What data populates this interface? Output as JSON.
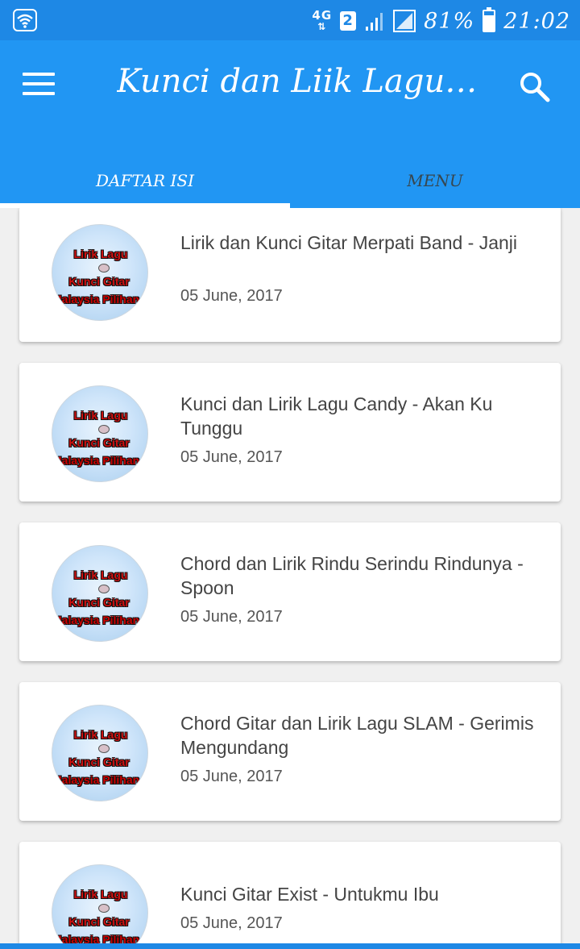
{
  "status_bar": {
    "network_type": "4G",
    "sim": "2",
    "battery": "81%",
    "time": "21:02"
  },
  "app_bar": {
    "title": "Kunci dan Liik Lagu Ma...",
    "menu_icon": "hamburger-menu-icon",
    "search_icon": "search-icon"
  },
  "tabs": [
    {
      "label": "DAFTAR ISI",
      "active": true
    },
    {
      "label": "MENU",
      "active": false
    }
  ],
  "thumbnail": {
    "line1": "Lirik Lagu",
    "line2": "Kunci Gitar",
    "line3": "Malaysia Pilihan"
  },
  "posts": [
    {
      "title": " Lirik dan Kunci Gitar Merpati Band - Janji",
      "date": "05 June, 2017"
    },
    {
      "title": "Kunci dan Lirik Lagu  Candy - Akan Ku Tunggu",
      "date": "05 June, 2017"
    },
    {
      "title": " Chord dan Lirik Rindu Serindu Rindunya - Spoon",
      "date": "05 June, 2017"
    },
    {
      "title": " Chord Gitar dan Lirik Lagu SLAM - Gerimis Mengundang",
      "date": "05 June, 2017"
    },
    {
      "title": " Kunci Gitar Exist - Untukmu Ibu",
      "date": "05 June, 2017"
    }
  ],
  "colors": {
    "status_bar": "#1e88e5",
    "app_bar": "#2196f3",
    "background": "#f0f0f0"
  }
}
